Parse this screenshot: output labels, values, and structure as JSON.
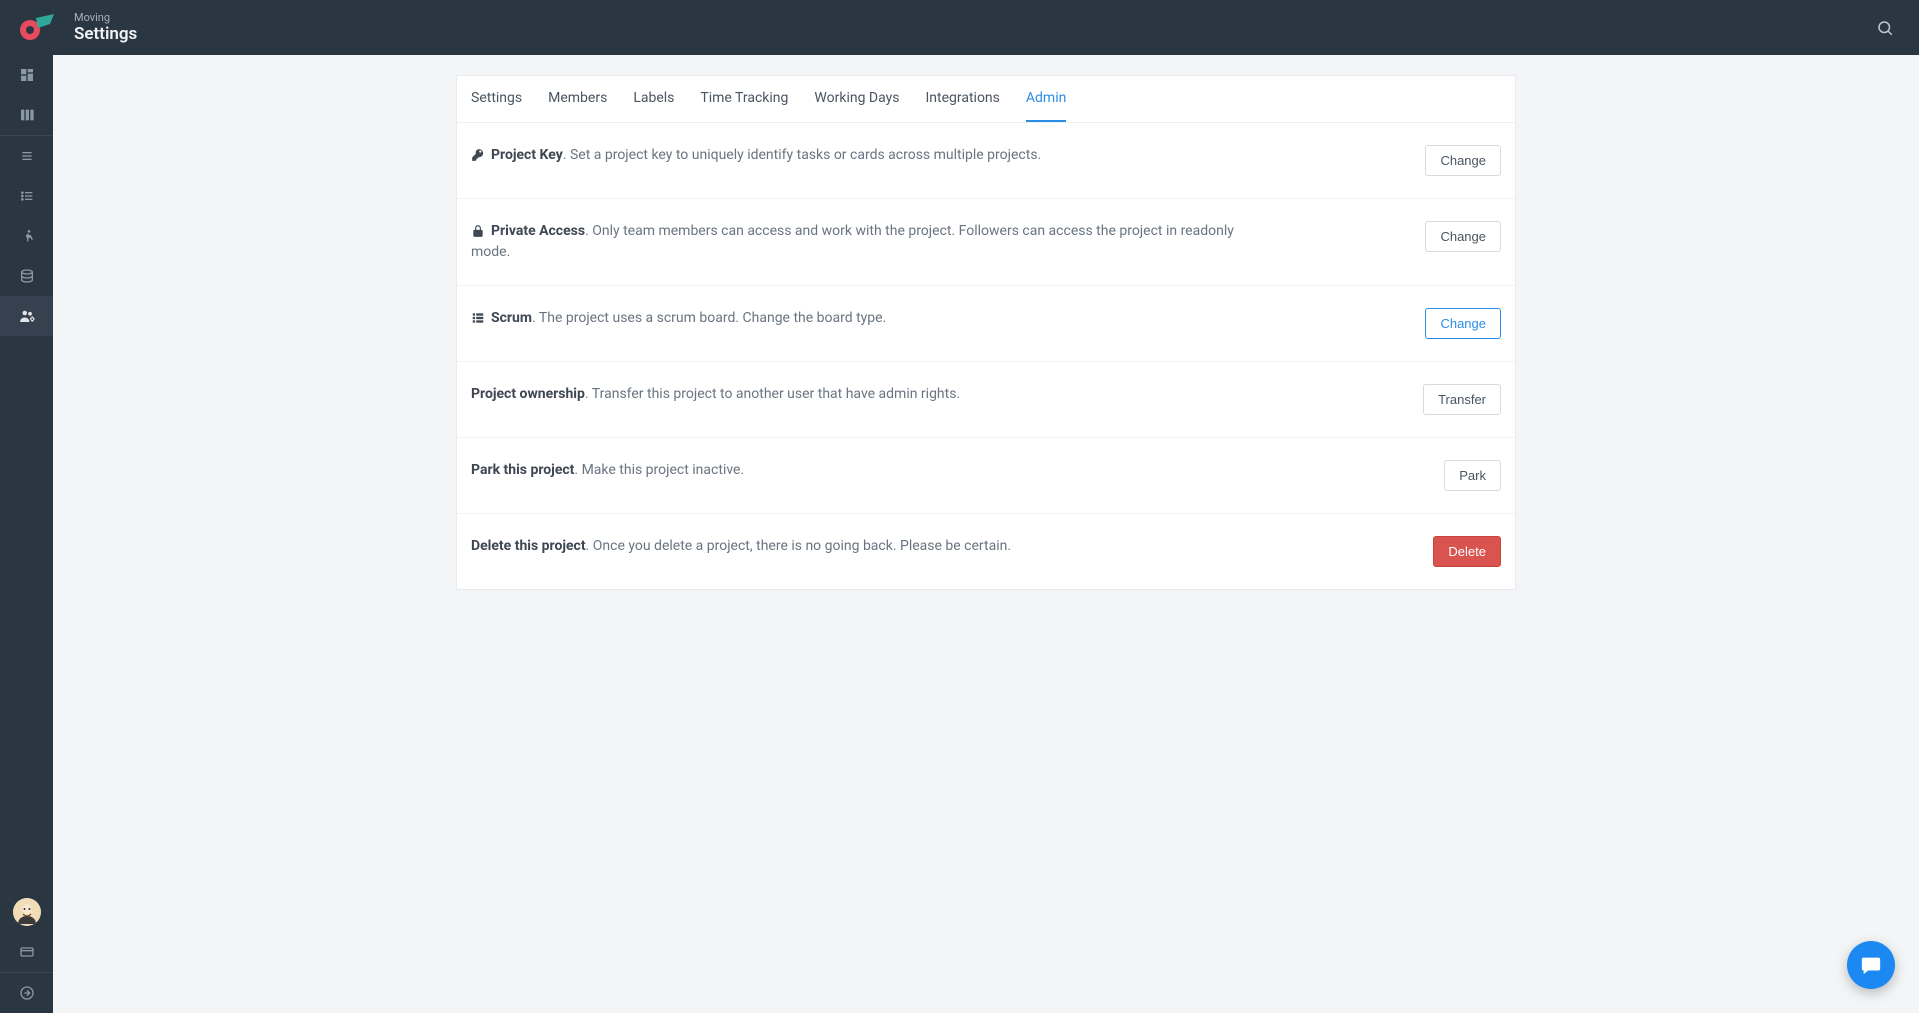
{
  "header": {
    "subtitle": "Moving",
    "title": "Settings"
  },
  "tabs": [
    {
      "id": "settings",
      "label": "Settings"
    },
    {
      "id": "members",
      "label": "Members"
    },
    {
      "id": "labels",
      "label": "Labels"
    },
    {
      "id": "time",
      "label": "Time Tracking"
    },
    {
      "id": "working",
      "label": "Working Days"
    },
    {
      "id": "integrations",
      "label": "Integrations"
    },
    {
      "id": "admin",
      "label": "Admin"
    }
  ],
  "activeTab": "admin",
  "rows": {
    "projectKey": {
      "title": "Project Key",
      "desc": ". Set a project key to uniquely identify tasks or cards across multiple projects.",
      "button": "Change"
    },
    "privateAccess": {
      "title": "Private Access",
      "desc": ". Only team members can access and work with the project. Followers can access the project in readonly mode.",
      "button": "Change"
    },
    "scrum": {
      "title": "Scrum",
      "desc": ". The project uses a scrum board. Change the board type.",
      "button": "Change"
    },
    "ownership": {
      "title": "Project ownership",
      "desc": ". Transfer this project to another user that have admin rights.",
      "button": "Transfer"
    },
    "park": {
      "title": "Park this project",
      "desc": ". Make this project inactive.",
      "button": "Park"
    },
    "delete": {
      "title": "Delete this project",
      "desc": ". Once you delete a project, there is no going back. Please be certain.",
      "button": "Delete"
    }
  }
}
